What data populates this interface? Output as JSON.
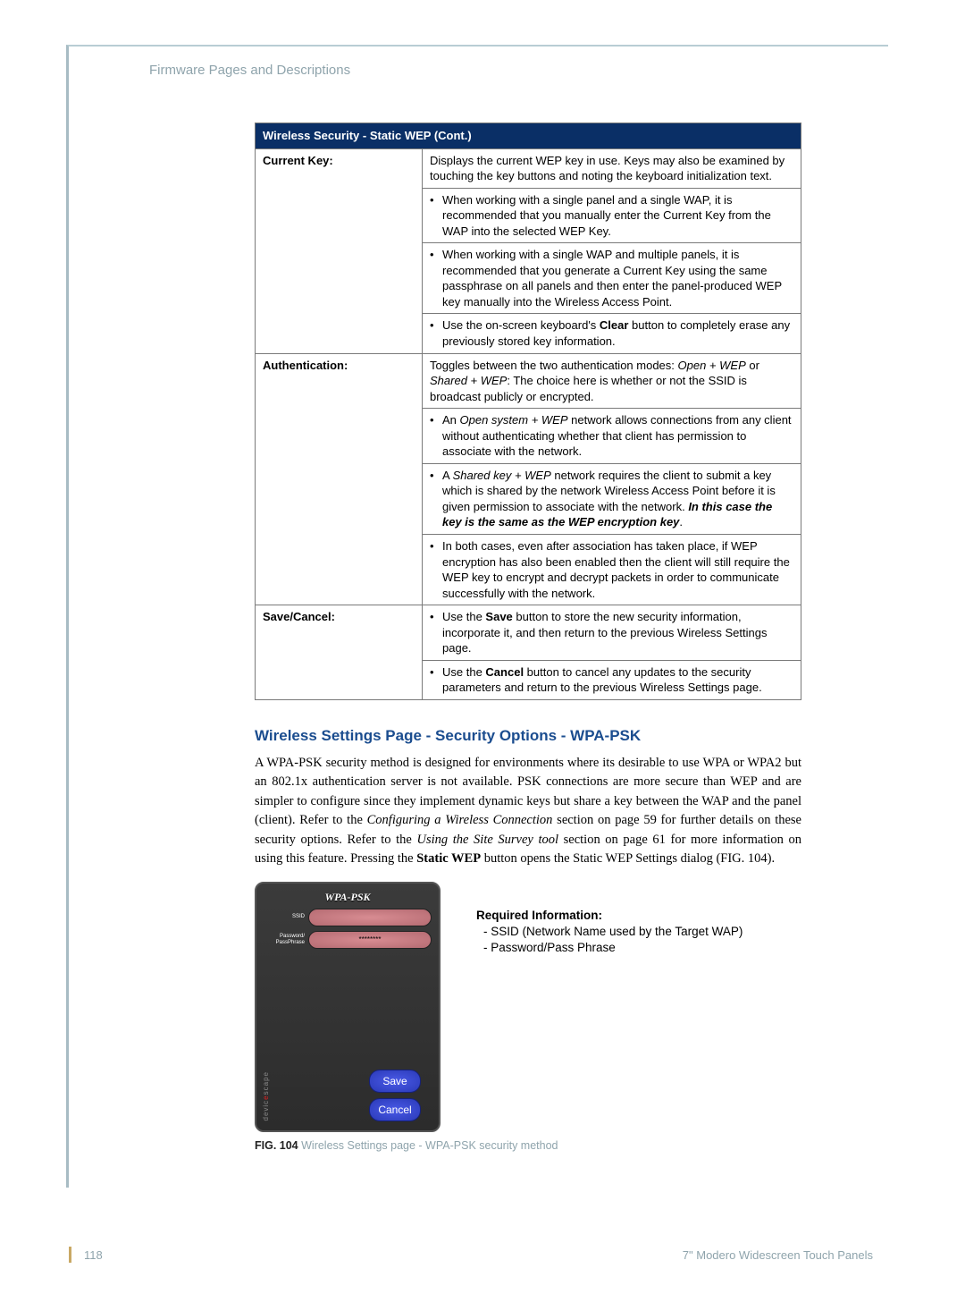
{
  "breadcrumb": "Firmware Pages and Descriptions",
  "table": {
    "header": "Wireless Security - Static WEP (Cont.)",
    "rows": [
      {
        "label": "Current Key:",
        "cells": [
          {
            "text": "Displays the current WEP key in use. Keys may also be examined by touching the key buttons and noting the keyboard initialization text."
          },
          {
            "bullet": true,
            "text": "When working with a single panel and a single WAP, it is recommended that you manually enter the Current Key from the WAP into the selected WEP Key."
          },
          {
            "bullet": true,
            "text": "When working with a single WAP and multiple panels, it is recommended that you generate a Current Key using the same passphrase on all panels and then enter the panel-produced WEP key manually into the Wireless Access Point."
          },
          {
            "bullet": true,
            "pre": "Use the on-screen keyboard's ",
            "bold": "Clear",
            "post": " button to completely erase any previously stored key information."
          }
        ]
      },
      {
        "label": "Authentication:",
        "cells": [
          {
            "pre": "Toggles between the two authentication modes: ",
            "ital": "Open + WEP",
            "mid": " or ",
            "ital2": "Shared + WEP",
            "post": ": The choice here is whether or not the SSID is broadcast publicly or encrypted."
          },
          {
            "bullet": true,
            "pre": "An ",
            "ital": "Open system + WEP",
            "post": " network allows connections from any client without authenticating whether that client has permission to associate with the network."
          },
          {
            "bullet": true,
            "pre": "A ",
            "ital": "Shared key + WEP",
            "post": " network requires the client to submit a key which is shared by the network Wireless Access Point before it is given permission to associate with the network. ",
            "boldital": "In this case the key is the same as the WEP encryption key",
            "post2": "."
          },
          {
            "bullet": true,
            "text": "In both cases, even after association has taken place, if WEP encryption has also been enabled then the client will still require the WEP key to encrypt and decrypt packets in order to communicate successfully with the network."
          }
        ]
      },
      {
        "label": "Save/Cancel:",
        "cells": [
          {
            "bullet": true,
            "pre": "Use the ",
            "bold": "Save",
            "post": " button to store the new security information, incorporate it, and then return to the previous Wireless Settings page."
          },
          {
            "bullet": true,
            "pre": "Use the ",
            "bold": "Cancel",
            "post": " button to cancel any updates to the security parameters and return to the previous Wireless Settings page."
          }
        ]
      }
    ]
  },
  "section_heading": "Wireless Settings Page - Security Options - WPA-PSK",
  "para": {
    "t1": "A WPA-PSK security method is designed for environments where its desirable to use WPA or WPA2 but an 802.1x authentication server is not available. PSK connections are more secure than WEP and are simpler to configure since they implement dynamic keys but share a key between the WAP and the panel (client). Refer to the ",
    "i1": "Configuring a Wireless Connection",
    "t2": " section on page 59 for further details on these security options. Refer to the ",
    "i2": "Using the Site Survey tool",
    "t3": " section on page 61 for more information on using this feature. Pressing the ",
    "b1": "Static WEP",
    "t4": " button opens the Static WEP Settings dialog (FIG. 104)."
  },
  "device": {
    "title": "WPA-PSK",
    "ssid_label": "SSID",
    "pass_label": "Password/\nPassPhrase",
    "pass_value": "********",
    "save": "Save",
    "cancel": "Cancel",
    "brand_pre": "devic",
    "brand_e": "e",
    "brand_post": "scape"
  },
  "req": {
    "title": "Required Information:",
    "items": [
      "- SSID (Network Name used by the Target WAP)",
      "- Password/Pass Phrase"
    ]
  },
  "fig": {
    "label": "FIG. 104",
    "text": "  Wireless Settings page - WPA-PSK security method"
  },
  "footer": {
    "page": "118",
    "right": "7\" Modero Widescreen Touch Panels"
  }
}
